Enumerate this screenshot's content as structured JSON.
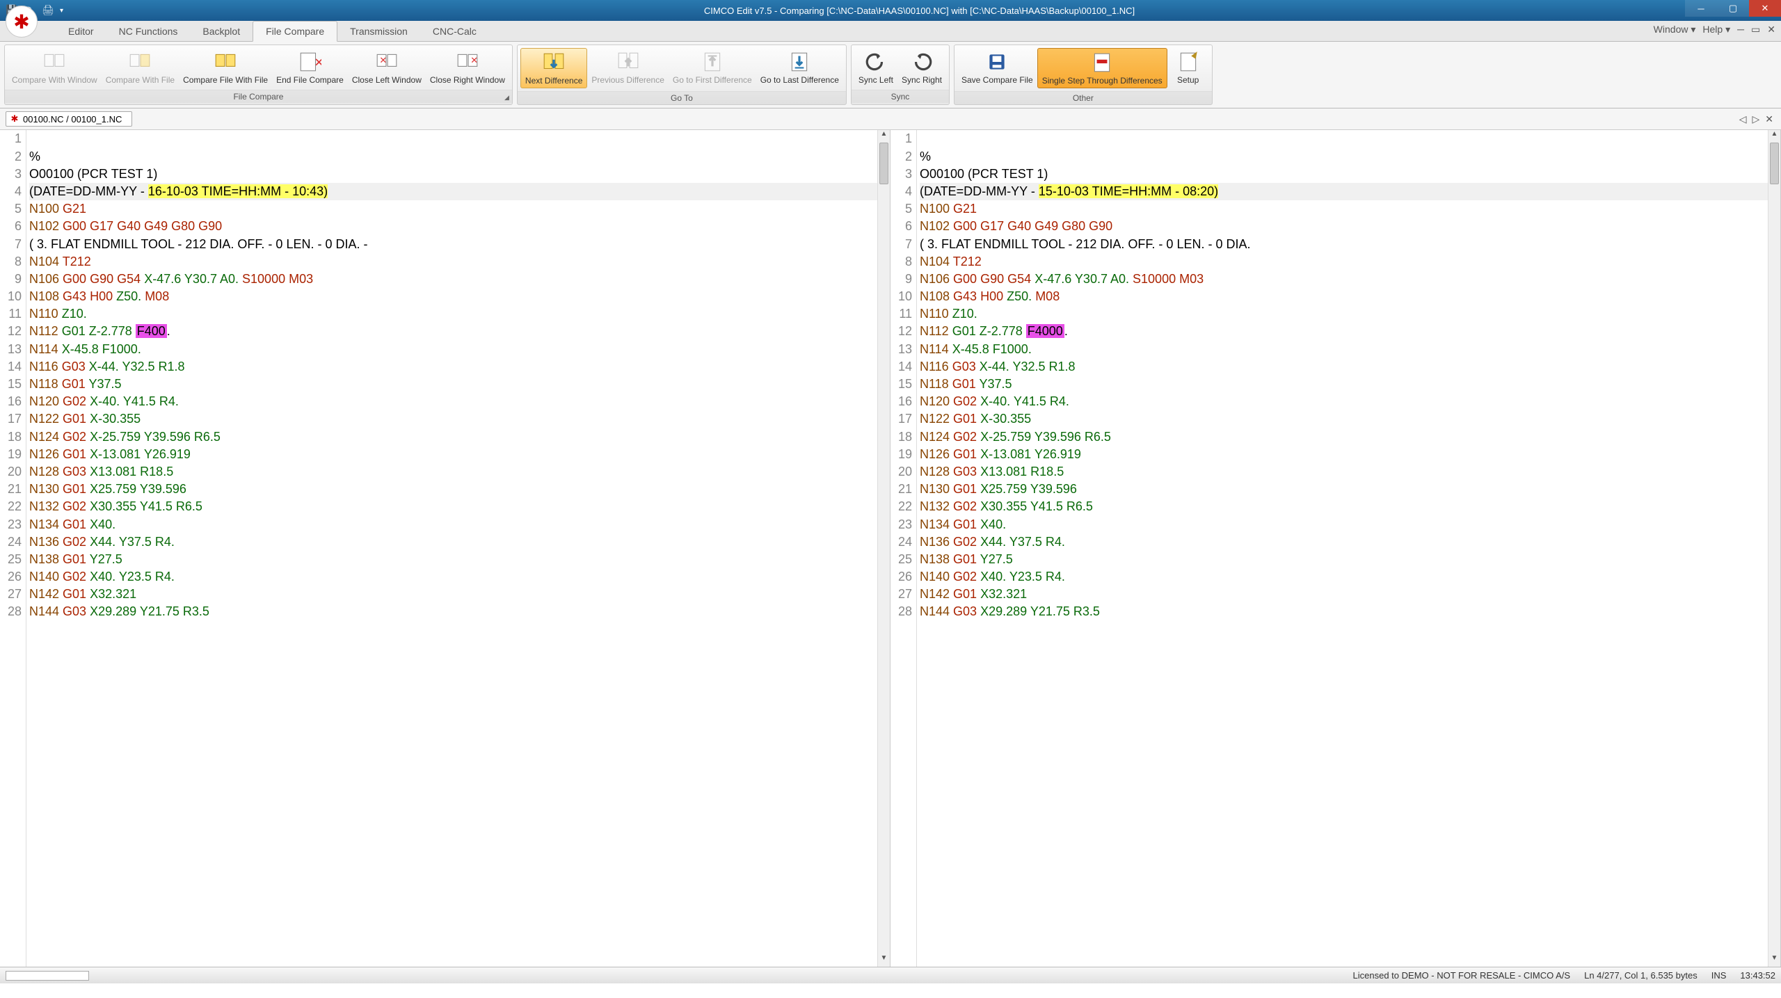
{
  "title": "CIMCO Edit v7.5 - Comparing [C:\\NC-Data\\HAAS\\00100.NC] with [C:\\NC-Data\\HAAS\\Backup\\00100_1.NC]",
  "tabs": [
    "Editor",
    "NC Functions",
    "Backplot",
    "File Compare",
    "Transmission",
    "CNC-Calc"
  ],
  "active_tab": 3,
  "tabbar_right": {
    "window": "Window",
    "help": "Help"
  },
  "ribbon": {
    "file_compare": {
      "label": "File Compare",
      "compare_with_window": "Compare With\nWindow",
      "compare_with_file": "Compare\nWith File",
      "compare_file_with_file": "Compare File\nWith File",
      "end_file_compare": "End File\nCompare",
      "close_left_window": "Close Left\nWindow",
      "close_right_window": "Close Right\nWindow"
    },
    "go_to": {
      "label": "Go To",
      "next_diff": "Next\nDifference",
      "prev_diff": "Previous\nDifference",
      "first_diff": "Go to First\nDifference",
      "last_diff": "Go to Last\nDifference"
    },
    "sync": {
      "label": "Sync",
      "left": "Sync\nLeft",
      "right": "Sync\nRight"
    },
    "other": {
      "label": "Other",
      "save": "Save Compare\nFile",
      "single_step": "Single Step Through\nDifferences",
      "setup": "Setup"
    }
  },
  "doc_tab": "00100.NC / 00100_1.NC",
  "left_lines": [
    {
      "n": 1,
      "raw": ""
    },
    {
      "n": 2,
      "raw": "%"
    },
    {
      "n": 3,
      "raw": "O00100 (PCR TEST 1)"
    },
    {
      "n": 4,
      "prefix": "(DATE=DD-MM-YY - ",
      "diff": "16-10-03 TIME=HH:MM - 10:43)",
      "active": true
    },
    {
      "n": 5,
      "nword": "N100",
      "rest": " G21"
    },
    {
      "n": 6,
      "nword": "N102",
      "rest": " G00 G17 G40 G49 G80 G90"
    },
    {
      "n": 7,
      "raw": "( 3. FLAT ENDMILL TOOL - 212 DIA. OFF. - 0 LEN. - 0 DIA. -"
    },
    {
      "n": 8,
      "nword": "N104",
      "rest": " T212"
    },
    {
      "n": 9,
      "nword": "N106",
      "rest": " G00 G90 G54 X-47.6 Y30.7 A0. S10000 M03",
      "xyz": true
    },
    {
      "n": 10,
      "nword": "N108",
      "rest": " G43 H00 Z50. M08",
      "xyz": true
    },
    {
      "n": 11,
      "nword": "N110",
      "rest": " Z10.",
      "xyz": true
    },
    {
      "n": 12,
      "nword": "N112",
      "pre": " G01 Z-2.778 ",
      "cur": "F400",
      "post": ".",
      "xyz": true
    },
    {
      "n": 13,
      "nword": "N114",
      "rest": " X-45.8 F1000.",
      "xyz": true
    },
    {
      "n": 14,
      "nword": "N116",
      "rest": " G03 X-44. Y32.5 R1.8",
      "xyz": true
    },
    {
      "n": 15,
      "nword": "N118",
      "rest": " G01 Y37.5",
      "xyz": true
    },
    {
      "n": 16,
      "nword": "N120",
      "rest": " G02 X-40. Y41.5 R4.",
      "xyz": true
    },
    {
      "n": 17,
      "nword": "N122",
      "rest": " G01 X-30.355",
      "xyz": true
    },
    {
      "n": 18,
      "nword": "N124",
      "rest": " G02 X-25.759 Y39.596 R6.5",
      "xyz": true
    },
    {
      "n": 19,
      "nword": "N126",
      "rest": " G01 X-13.081 Y26.919",
      "xyz": true
    },
    {
      "n": 20,
      "nword": "N128",
      "rest": " G03 X13.081 R18.5",
      "xyz": true
    },
    {
      "n": 21,
      "nword": "N130",
      "rest": " G01 X25.759 Y39.596",
      "xyz": true
    },
    {
      "n": 22,
      "nword": "N132",
      "rest": " G02 X30.355 Y41.5 R6.5",
      "xyz": true
    },
    {
      "n": 23,
      "nword": "N134",
      "rest": " G01 X40.",
      "xyz": true
    },
    {
      "n": 24,
      "nword": "N136",
      "rest": " G02 X44. Y37.5 R4.",
      "xyz": true
    },
    {
      "n": 25,
      "nword": "N138",
      "rest": " G01 Y27.5",
      "xyz": true
    },
    {
      "n": 26,
      "nword": "N140",
      "rest": " G02 X40. Y23.5 R4.",
      "xyz": true
    },
    {
      "n": 27,
      "nword": "N142",
      "rest": " G01 X32.321",
      "xyz": true
    },
    {
      "n": 28,
      "nword": "N144",
      "rest": " G03 X29.289 Y21.75 R3.5",
      "xyz": true
    }
  ],
  "right_lines": [
    {
      "n": 1,
      "raw": ""
    },
    {
      "n": 2,
      "raw": "%"
    },
    {
      "n": 3,
      "raw": "O00100 (PCR TEST 1)"
    },
    {
      "n": 4,
      "prefix": "(DATE=DD-MM-YY - ",
      "diff": "15-10-03 TIME=HH:MM - 08:20)",
      "active": true
    },
    {
      "n": 5,
      "nword": "N100",
      "rest": " G21"
    },
    {
      "n": 6,
      "nword": "N102",
      "rest": " G00 G17 G40 G49 G80 G90"
    },
    {
      "n": 7,
      "raw": "( 3. FLAT ENDMILL TOOL - 212 DIA. OFF. - 0 LEN. - 0 DIA."
    },
    {
      "n": 8,
      "nword": "N104",
      "rest": " T212"
    },
    {
      "n": 9,
      "nword": "N106",
      "rest": " G00 G90 G54 X-47.6 Y30.7 A0. S10000 M03",
      "xyz": true
    },
    {
      "n": 10,
      "nword": "N108",
      "rest": " G43 H00 Z50. M08",
      "xyz": true
    },
    {
      "n": 11,
      "nword": "N110",
      "rest": " Z10.",
      "xyz": true
    },
    {
      "n": 12,
      "nword": "N112",
      "pre": " G01 Z-2.778 ",
      "cur": "F4000",
      "post": ".",
      "xyz": true
    },
    {
      "n": 13,
      "nword": "N114",
      "rest": " X-45.8 F1000.",
      "xyz": true
    },
    {
      "n": 14,
      "nword": "N116",
      "rest": " G03 X-44. Y32.5 R1.8",
      "xyz": true
    },
    {
      "n": 15,
      "nword": "N118",
      "rest": " G01 Y37.5",
      "xyz": true
    },
    {
      "n": 16,
      "nword": "N120",
      "rest": " G02 X-40. Y41.5 R4.",
      "xyz": true
    },
    {
      "n": 17,
      "nword": "N122",
      "rest": " G01 X-30.355",
      "xyz": true
    },
    {
      "n": 18,
      "nword": "N124",
      "rest": " G02 X-25.759 Y39.596 R6.5",
      "xyz": true
    },
    {
      "n": 19,
      "nword": "N126",
      "rest": " G01 X-13.081 Y26.919",
      "xyz": true
    },
    {
      "n": 20,
      "nword": "N128",
      "rest": " G03 X13.081 R18.5",
      "xyz": true
    },
    {
      "n": 21,
      "nword": "N130",
      "rest": " G01 X25.759 Y39.596",
      "xyz": true
    },
    {
      "n": 22,
      "nword": "N132",
      "rest": " G02 X30.355 Y41.5 R6.5",
      "xyz": true
    },
    {
      "n": 23,
      "nword": "N134",
      "rest": " G01 X40.",
      "xyz": true
    },
    {
      "n": 24,
      "nword": "N136",
      "rest": " G02 X44. Y37.5 R4.",
      "xyz": true
    },
    {
      "n": 25,
      "nword": "N138",
      "rest": " G01 Y27.5",
      "xyz": true
    },
    {
      "n": 26,
      "nword": "N140",
      "rest": " G02 X40. Y23.5 R4.",
      "xyz": true
    },
    {
      "n": 27,
      "nword": "N142",
      "rest": " G01 X32.321",
      "xyz": true
    },
    {
      "n": 28,
      "nword": "N144",
      "rest": " G03 X29.289 Y21.75 R3.5",
      "xyz": true
    }
  ],
  "status": {
    "license": "Licensed to DEMO - NOT FOR RESALE - CIMCO A/S",
    "pos": "Ln 4/277, Col 1, 6.535 bytes",
    "ins": "INS",
    "time": "13:43:52"
  }
}
